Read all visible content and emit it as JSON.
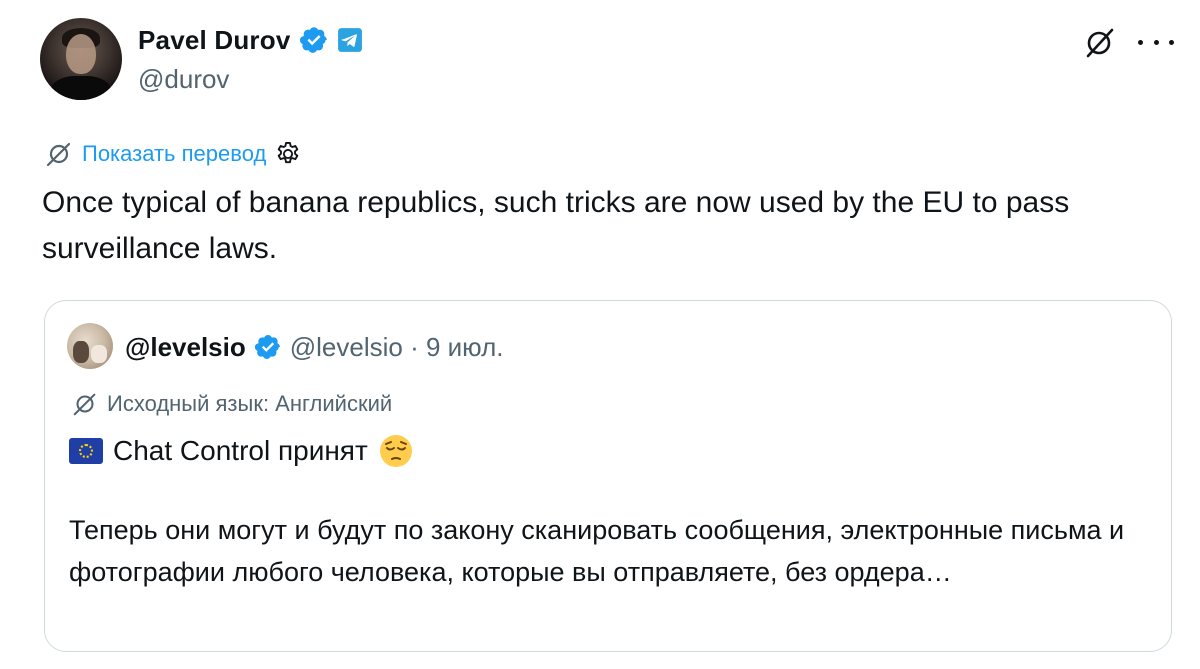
{
  "author": {
    "display_name": "Pavel Durov",
    "handle": "@durov",
    "verified": true,
    "affiliation_badge": "telegram-icon"
  },
  "actions": {
    "translate_icon": "translate-icon",
    "more_icon": "more-icon"
  },
  "translate": {
    "link_label": "Показать перевод",
    "settings_icon": "gear-icon"
  },
  "tweet": {
    "text": "Once typical of banana republics, such tricks are now used by the EU to pass surveillance laws."
  },
  "quote": {
    "display_name": "@levelsio",
    "handle_date": "@levelsio · 9 июл.",
    "verified": true,
    "source_language": "Исходный язык: Английский",
    "title": "Chat Control принят",
    "flag_icon": "eu-flag-icon",
    "emoji_icon": "pensive-face-icon",
    "body": "Теперь они могут и будут по закону сканировать сообщения, электронные письма и фотографии любого человека, которые вы отправляете, без ордера…"
  },
  "colors": {
    "text": "#0f1419",
    "muted": "#536471",
    "link": "#1d9bf0",
    "border": "#cfd9de",
    "verified": "#1d9bf0",
    "telegram": "#2aa3e0"
  }
}
